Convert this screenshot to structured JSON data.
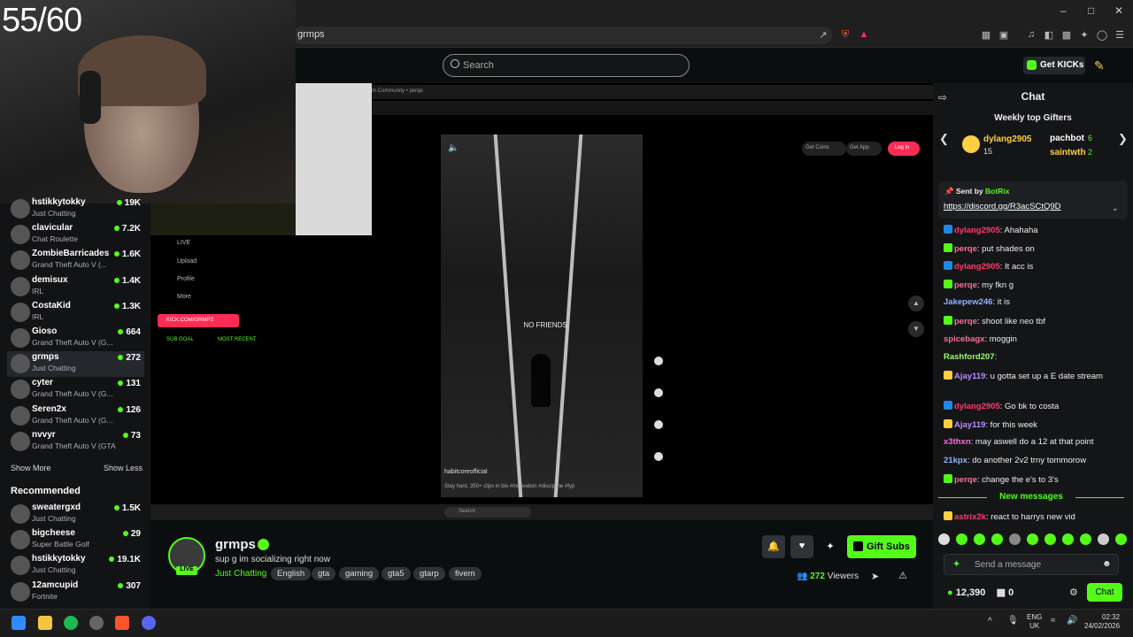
{
  "overlay": {
    "counter": "55/60"
  },
  "browser": {
    "address": "grmps"
  },
  "header": {
    "search_placeholder": "Search",
    "get_kicks_label": "Get KICKs"
  },
  "embedded_stream": {
    "tiktok_text": "NO FRIENDS",
    "tiktok_user": "habitcoreofficial",
    "tiktok_desc": "Stay hard. 350+ clips in bio #motivation #discipline #fyp",
    "nav": [
      "LIVE",
      "Upload",
      "Profile",
      "More"
    ],
    "kick_button": "KICK.COM/GRMPS",
    "sub_goal": "SUB GOAL",
    "most_recent": "MOST RECENT",
    "get_coins": "Get Coins",
    "get_app": "Get App",
    "login": "Log in",
    "tiktok_tab_title": "m Community • perqe",
    "inner_search": "Search"
  },
  "sidebar": {
    "channels": [
      {
        "name": "hstikkytokky",
        "category": "Just Chatting",
        "viewers": "19K"
      },
      {
        "name": "clavicular",
        "category": "Chat Roulette",
        "viewers": "7.2K"
      },
      {
        "name": "ZombieBarricades",
        "category": "Grand Theft Auto V (...",
        "viewers": "1.6K"
      },
      {
        "name": "demisux",
        "category": "IRL",
        "viewers": "1.4K"
      },
      {
        "name": "CostaKid",
        "category": "IRL",
        "viewers": "1.3K"
      },
      {
        "name": "Gioso",
        "category": "Grand Theft Auto V (G...",
        "viewers": "664"
      },
      {
        "name": "grmps",
        "category": "Just Chatting",
        "viewers": "272"
      },
      {
        "name": "cyter",
        "category": "Grand Theft Auto V (G...",
        "viewers": "131"
      },
      {
        "name": "Seren2x",
        "category": "Grand Theft Auto V (G...",
        "viewers": "126"
      },
      {
        "name": "nvvyr",
        "category": "Grand Theft Auto V (GTA)",
        "viewers": "73"
      }
    ],
    "show_more": "Show More",
    "show_less": "Show Less",
    "recommended_title": "Recommended",
    "recommended": [
      {
        "name": "sweatergxd",
        "category": "Just Chatting",
        "viewers": "1.5K"
      },
      {
        "name": "bigcheese",
        "category": "Super Battle Golf",
        "viewers": "29"
      },
      {
        "name": "hstikkytokky",
        "category": "Just Chatting",
        "viewers": "19.1K"
      },
      {
        "name": "12amcupid",
        "category": "Fortnite",
        "viewers": "307"
      }
    ]
  },
  "stream": {
    "streamer": "grmps",
    "live_badge": "LIVE",
    "title": "sup g im socializing right now",
    "category": "Just Chatting",
    "tags": [
      "English",
      "gta",
      "gaming",
      "gta5",
      "gtarp",
      "fivem"
    ],
    "gift_subs_label": "Gift Subs",
    "viewers": "272",
    "viewers_label": "Viewers"
  },
  "chat": {
    "title": "Chat",
    "gifters_title": "Weekly top Gifters",
    "gifters": [
      {
        "name": "dylang2905",
        "count": "15"
      },
      {
        "name": "pachbot",
        "count": "6"
      },
      {
        "name": "saintwth",
        "count": "2"
      }
    ],
    "pinned_by_prefix": "Sent by",
    "pinned_by": "BotRix",
    "pinned_link": "https://discord.gg/R3acSCtQ9D",
    "messages": [
      {
        "user": "dylang2905",
        "text": ": Ahahaha",
        "color": "#ff3b6b"
      },
      {
        "user": "perqe",
        "text": ": put shades on",
        "color": "#ff6b9a"
      },
      {
        "user": "dylang2905",
        "text": ": It acc is",
        "color": "#ff3b6b"
      },
      {
        "user": "perqe",
        "text": ": my fkn g",
        "color": "#ff6b9a"
      },
      {
        "user": "Jakepew246",
        "text": ": it is",
        "color": "#8fb3ff"
      },
      {
        "user": "perqe",
        "text": ": shoot like neo tbf",
        "color": "#ff6b9a"
      },
      {
        "user": "spicebagx",
        "text": ": moggin",
        "color": "#ff6b9a"
      },
      {
        "user": "Rashford207",
        "text": ":",
        "color": "#9dff6b"
      },
      {
        "user": "Ajay119",
        "text": ": u gotta set up a E date stream",
        "color": "#b98cff"
      },
      {
        "user": "dylang2905",
        "text": ": Go bk to costa",
        "color": "#ff3b6b"
      },
      {
        "user": "Ajay119",
        "text": ": for this week",
        "color": "#b98cff"
      },
      {
        "user": "x3thxn",
        "text": ": may aswell do a 12 at that point",
        "color": "#ff6bd6"
      },
      {
        "user": "21kpx",
        "text": ": do another 2v2 trny tommorow",
        "color": "#8fb3ff"
      },
      {
        "user": "perqe",
        "text": ": change the e's to 3's",
        "color": "#ff6b9a"
      }
    ],
    "new_messages": "New messages",
    "last_message": {
      "user": "astrix2k",
      "text": ": react to harrys new vid",
      "color": "#ff3b6b"
    },
    "input_placeholder": "Send a message",
    "kicks_balance": "12,390",
    "points": "0",
    "send_label": "Chat"
  },
  "taskbar": {
    "lang": "ENG",
    "region": "UK",
    "time": "02:32",
    "date": "24/02/2026"
  },
  "colors": {
    "accent": "#53fc18",
    "tiktok": "#fe2c55"
  }
}
